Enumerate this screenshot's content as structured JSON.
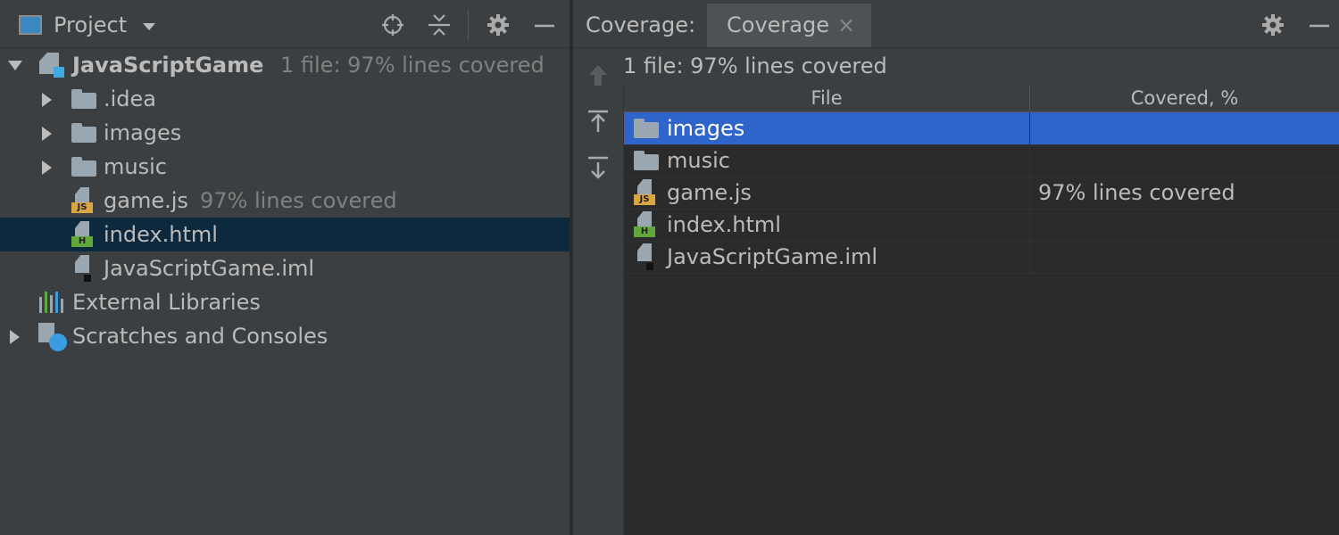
{
  "project": {
    "title": "Project",
    "icons": [
      "locate-icon",
      "collapse-all-icon",
      "gear-icon",
      "minimize-icon"
    ],
    "tree": [
      {
        "label": "JavaScriptGame",
        "hint": "1 file: 97% lines covered",
        "type": "module",
        "expanded": true,
        "bold": true
      },
      {
        "label": ".idea",
        "type": "folder",
        "expandable": true
      },
      {
        "label": "images",
        "type": "folder",
        "expandable": true
      },
      {
        "label": "music",
        "type": "folder",
        "expandable": true
      },
      {
        "label": "game.js",
        "hint": "97% lines covered",
        "type": "js-file"
      },
      {
        "label": "index.html",
        "type": "html-file",
        "selected": true
      },
      {
        "label": "JavaScriptGame.iml",
        "type": "iml-file"
      },
      {
        "label": "External Libraries",
        "type": "libraries"
      },
      {
        "label": "Scratches and Consoles",
        "type": "scratches",
        "expandable": true
      }
    ]
  },
  "coverage": {
    "header_label": "Coverage:",
    "tab_label": "Coverage",
    "summary": "1 file: 97% lines covered",
    "columns": [
      "File",
      "Covered, %"
    ],
    "rows": [
      {
        "name": "images",
        "type": "folder",
        "covered": "",
        "selected": true
      },
      {
        "name": "music",
        "type": "folder",
        "covered": ""
      },
      {
        "name": "game.js",
        "type": "js-file",
        "covered": "97% lines covered"
      },
      {
        "name": "index.html",
        "type": "html-file",
        "covered": ""
      },
      {
        "name": "JavaScriptGame.iml",
        "type": "iml-file",
        "covered": ""
      }
    ]
  },
  "colors": {
    "background": "#3c3f41",
    "selection_tree": "#0d293e",
    "selection_table": "#2f65ca",
    "js_badge": "#d9a641",
    "html_badge": "#62a73b"
  }
}
